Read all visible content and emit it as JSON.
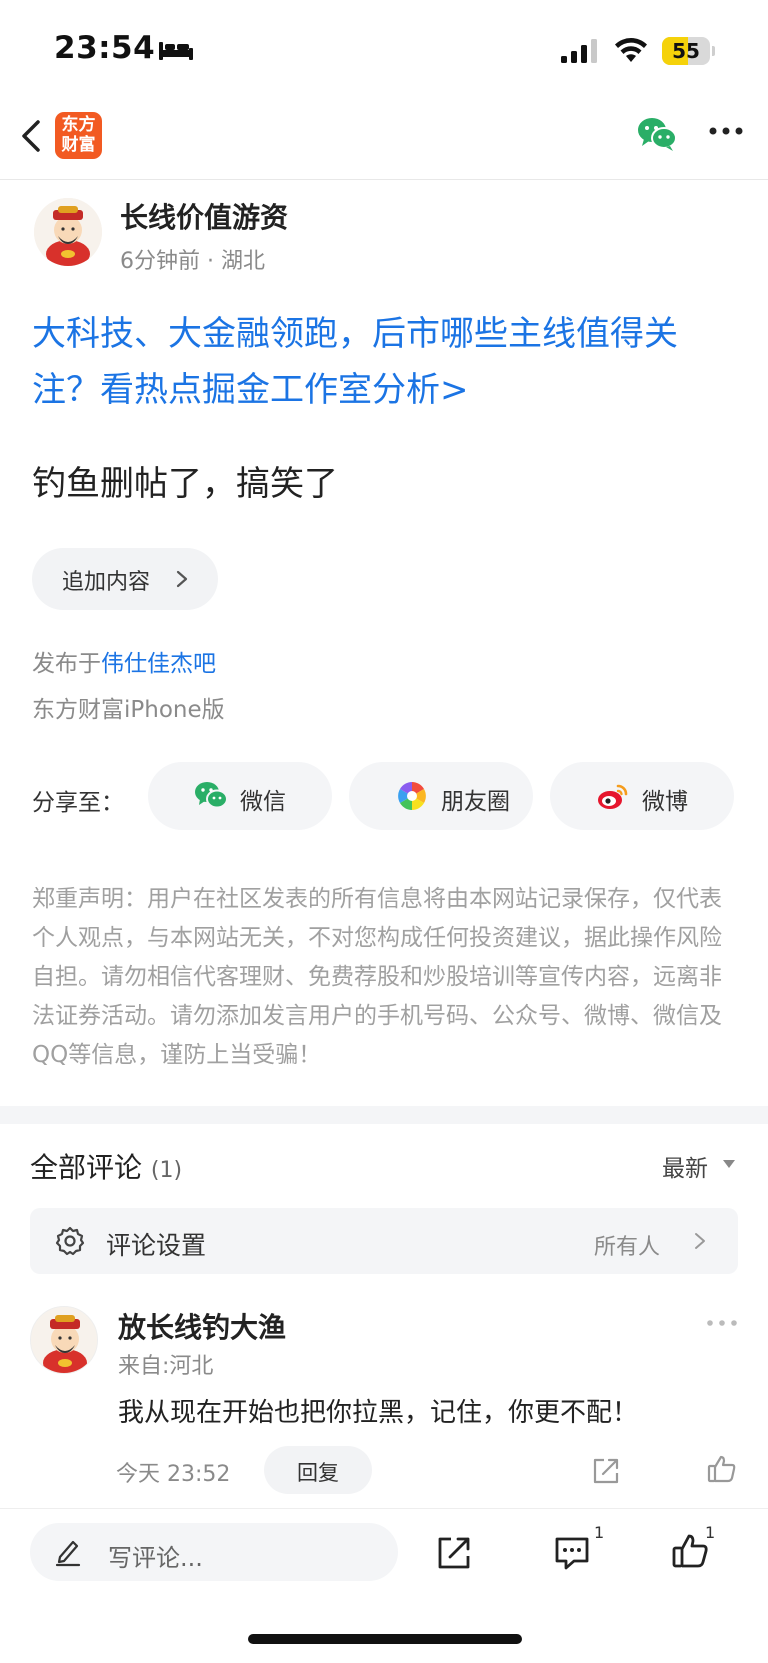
{
  "status_bar": {
    "time": "23:54",
    "battery_level": "55",
    "battery_fraction": 0.55,
    "icons": [
      "bed-icon",
      "signal-icon",
      "wifi-icon",
      "battery-icon"
    ]
  },
  "nav": {
    "back_icon": "chevron-left-icon",
    "app_logo": [
      "东方",
      "财富"
    ],
    "share_icon": "wechat-icon",
    "more_icon": "more-horizontal-icon"
  },
  "post": {
    "author": "长线价值游资",
    "meta": "6分钟前 · 湖北",
    "headline": "大科技、大金融领跑，后市哪些主线值得关注？看热点掘金工作室分析>",
    "body": "钓鱼删帖了，搞笑了",
    "append_label": "追加内容",
    "published_prefix": "发布于",
    "forum": "伟仕佳杰吧",
    "client": "东方财富iPhone版"
  },
  "share": {
    "label": "分享至：",
    "buttons": [
      {
        "label": "微信",
        "icon": "wechat-icon"
      },
      {
        "label": "朋友圈",
        "icon": "moments-icon"
      },
      {
        "label": "微博",
        "icon": "weibo-icon"
      }
    ]
  },
  "disclaimer": "郑重声明：用户在社区发表的所有信息将由本网站记录保存，仅代表个人观点，与本网站无关，不对您构成任何投资建议，据此操作风险自担。请勿相信代客理财、免费荐股和炒股培训等宣传内容，远离非法证券活动。请勿添加发言用户的手机号码、公众号、微博、微信及QQ等信息，谨防上当受骗！",
  "comments": {
    "title": "全部评论",
    "count": "(1)",
    "sort": "最新",
    "settings_label": "评论设置",
    "settings_value": "所有人",
    "items": [
      {
        "author": "放长线钓大渔",
        "location": "来自:河北",
        "text": "我从现在开始也把你拉黑，记住，你更不配！",
        "time": "今天 23:52",
        "reply_label": "回复"
      }
    ]
  },
  "bottom_bar": {
    "placeholder": "写评论...",
    "comment_count": "1",
    "like_count": "1"
  },
  "colors": {
    "link_blue": "#1b74e4",
    "brand_orange": "#f25a22",
    "wechat_green": "#2aae67",
    "battery_yellow": "#f5d20a"
  }
}
